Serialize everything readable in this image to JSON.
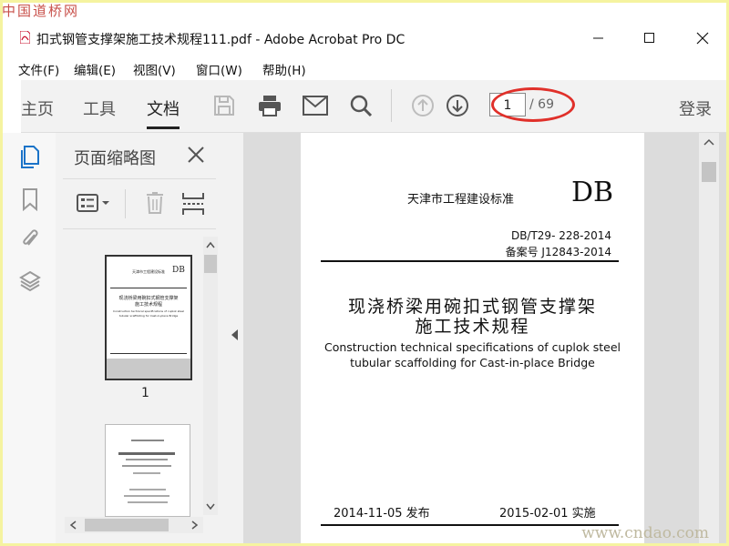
{
  "watermarks": {
    "top": "中国道桥网",
    "bottom": "www.cndao.com"
  },
  "window": {
    "title": "扣式钢管支撑架施工技术规程111.pdf - Adobe Acrobat Pro DC"
  },
  "menu": [
    "文件(F)",
    "编辑(E)",
    "视图(V)",
    "窗口(W)",
    "帮助(H)"
  ],
  "toolbar": {
    "tabs": [
      "主页",
      "工具",
      "文档"
    ],
    "active_tab": "文档",
    "current_page": "1",
    "total_pages": "/ 69",
    "login": "登录"
  },
  "thumbnails": {
    "title": "页面缩略图",
    "page_label": "1",
    "thumb1_lines": [
      "天津市工程建设标准",
      "DB",
      "现浇桥梁用碗扣式钢管支撑架",
      "施工技术规程",
      "Construction technical specifications of cuplok steel",
      "tubular scaffolding for Cast-in-place Bridge"
    ]
  },
  "document": {
    "standard_label": "天津市工程建设标准",
    "db": "DB",
    "code": "DB/T29- 228-2014",
    "record": "备案号 J12843-2014",
    "title_line1": "现浇桥梁用碗扣式钢管支撑架",
    "title_line2": "施工技术规程",
    "en_line1": "Construction technical specifications of cuplok steel",
    "en_line2": "tubular scaffolding for Cast-in-place Bridge",
    "issue_date": "2014-11-05 发布",
    "impl_date": "2015-02-01  实施"
  },
  "colors": {
    "highlight": "#e0302a",
    "pdf_red": "#c8102e"
  }
}
